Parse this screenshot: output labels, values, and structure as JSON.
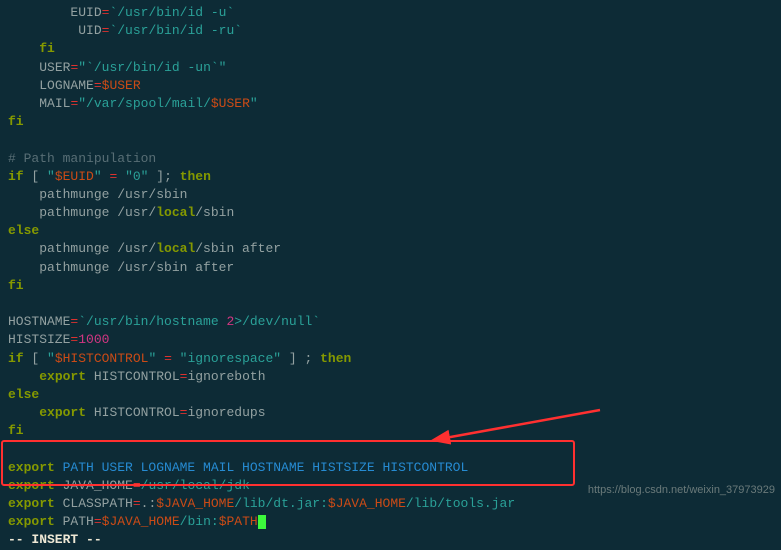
{
  "lines": {
    "l1_indent": "        ",
    "l1_var": "EUID",
    "l1_val": "`/usr/bin/id -u`",
    "l2_indent": "         ",
    "l2_var": "UID",
    "l2_val": "`/usr/bin/id -ru`",
    "l3": "    fi",
    "l4_indent": "    ",
    "l4_var": "USER",
    "l4_val": "\"`/usr/bin/id -un`\"",
    "l5_indent": "    ",
    "l5_var": "LOGNAME",
    "l5_val": "$USER",
    "l6_indent": "    ",
    "l6_var": "MAIL",
    "l6_val_a": "\"/var/spool/mail/",
    "l6_val_b": "$USER",
    "l6_val_c": "\"",
    "l7": "fi",
    "l9_comment": "# Path manipulation",
    "l10_if": "if",
    "l10_lb": " [ ",
    "l10_q1": "\"",
    "l10_var": "$EUID",
    "l10_q2": "\"",
    "l10_eq": " = ",
    "l10_zero": "\"0\"",
    "l10_rb": " ]; ",
    "l10_then": "then",
    "l11": "    pathmunge /usr/sbin",
    "l12_a": "    pathmunge /usr/",
    "l12_b": "local",
    "l12_c": "/sbin",
    "l13": "else",
    "l14_a": "    pathmunge /usr/",
    "l14_b": "local",
    "l14_c": "/sbin after",
    "l15": "    pathmunge /usr/sbin after",
    "l16": "fi",
    "l18_var": "HOSTNAME",
    "l18_val_a": "`/usr/bin/hostname ",
    "l18_val_b": "2",
    "l18_val_c": ">/dev/null`",
    "l19_var": "HISTSIZE",
    "l19_val": "1000",
    "l20_if": "if",
    "l20_lb": " [ ",
    "l20_q1": "\"",
    "l20_var": "$HISTCONTROL",
    "l20_q2": "\"",
    "l20_eq": " = ",
    "l20_val": "\"ignorespace\"",
    "l20_rb": " ] ; ",
    "l20_then": "then",
    "l21_indent": "    ",
    "l21_kw": "export",
    "l21_sp": " ",
    "l21_var": "HISTCONTROL",
    "l21_val": "ignoreboth",
    "l22": "else",
    "l23_indent": "    ",
    "l23_kw": "export",
    "l23_sp": " ",
    "l23_var": "HISTCONTROL",
    "l23_val": "ignoredups",
    "l24": "fi",
    "l26_kw": "export",
    "l26_rest": " PATH USER LOGNAME MAIL HOSTNAME HISTSIZE HISTCONTROL",
    "l27_kw": "export",
    "l27_sp": " ",
    "l27_var": "JAVA_HOME",
    "l27_val": "/usr/local/jdk",
    "l28_kw": "export",
    "l28_sp": " ",
    "l28_var": "CLASSPATH",
    "l28_v1": ".:",
    "l28_v2": "$JAVA_HOME",
    "l28_v3": "/lib/dt.jar:",
    "l28_v4": "$JAVA_HOME",
    "l28_v5": "/lib/tools.jar",
    "l29_kw": "export",
    "l29_sp": " ",
    "l29_var": "PATH",
    "l29_v1": "$JAVA_HOME",
    "l29_v2": "/bin:",
    "l29_v3": "$PATH",
    "status": "-- INSERT --"
  },
  "watermark": "https://blog.csdn.net/weixin_37973929"
}
